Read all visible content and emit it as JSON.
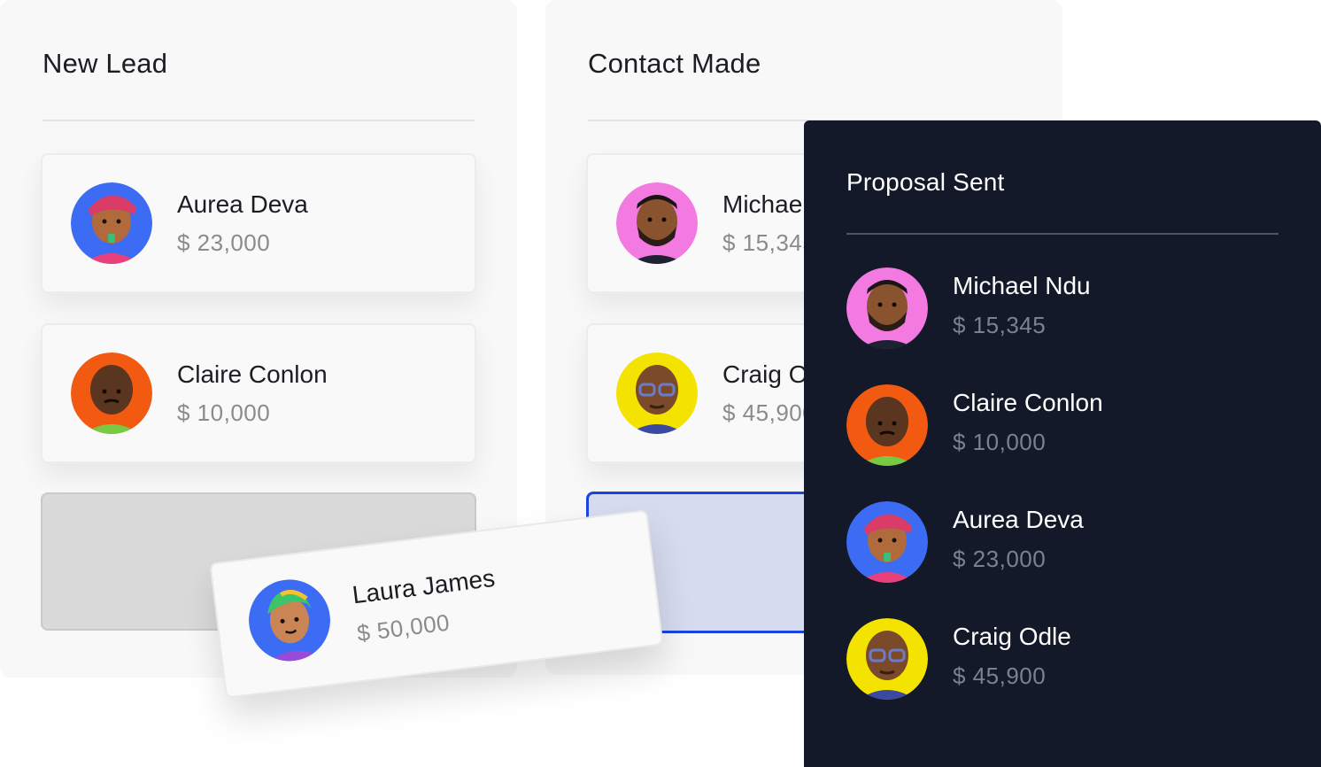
{
  "columns": {
    "new_lead": {
      "title": "New Lead",
      "cards": [
        {
          "name": "Aurea Deva",
          "amount": "$ 23,000"
        },
        {
          "name": "Claire Conlon",
          "amount": "$ 10,000"
        }
      ]
    },
    "contact_made": {
      "title": "Contact Made",
      "cards": [
        {
          "name": "Michael Ndu",
          "amount": "$ 15,345"
        },
        {
          "name": "Craig Odle",
          "amount": "$ 45,900"
        }
      ]
    },
    "proposal_sent": {
      "title": "Proposal Sent",
      "items": [
        {
          "name": "Michael Ndu",
          "amount": "$ 15,345"
        },
        {
          "name": "Claire Conlon",
          "amount": "$ 10,000"
        },
        {
          "name": "Aurea Deva",
          "amount": "$ 23,000"
        },
        {
          "name": "Craig Odle",
          "amount": "$ 45,900"
        }
      ]
    }
  },
  "dragging_card": {
    "name": "Laura James",
    "amount": "$ 50,000"
  },
  "colors": {
    "drop_target_border": "#1a44e0",
    "dark_panel": "#131929",
    "avatar_bg_aurea": "#3d6cf4",
    "avatar_bg_claire": "#f25a12",
    "avatar_bg_michael": "#f27ae0",
    "avatar_bg_craig": "#f4e200",
    "avatar_bg_laura": "#3d6cf4"
  }
}
